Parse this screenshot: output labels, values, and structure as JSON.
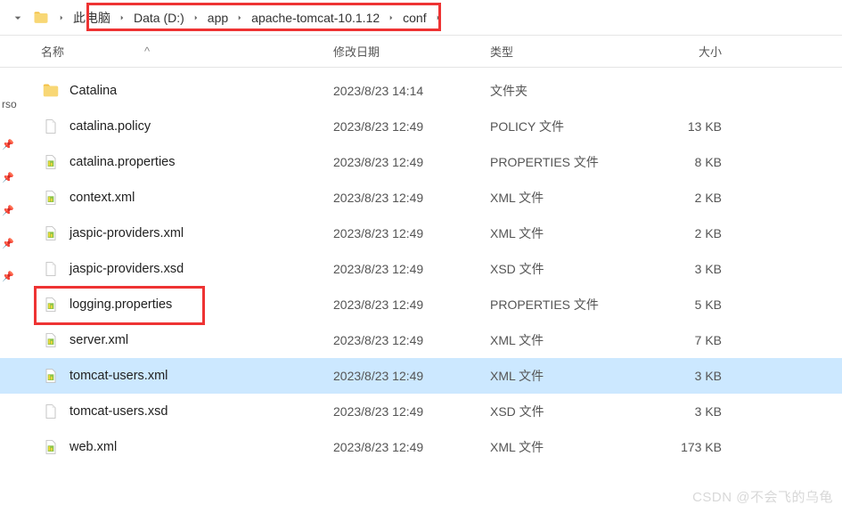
{
  "breadcrumb": {
    "items": [
      {
        "label": "此电脑"
      },
      {
        "label": "Data (D:)"
      },
      {
        "label": "app"
      },
      {
        "label": "apache-tomcat-10.1.12"
      },
      {
        "label": "conf"
      }
    ]
  },
  "headers": {
    "name": "名称",
    "date": "修改日期",
    "type": "类型",
    "size": "大小",
    "sort_indicator": "^"
  },
  "sidebar": {
    "label": "rso"
  },
  "files": [
    {
      "icon": "folder",
      "name": "Catalina",
      "date": "2023/8/23 14:14",
      "type": "文件夹",
      "size": "",
      "selected": false
    },
    {
      "icon": "file",
      "name": "catalina.policy",
      "date": "2023/8/23 12:49",
      "type": "POLICY 文件",
      "size": "13 KB",
      "selected": false
    },
    {
      "icon": "prop",
      "name": "catalina.properties",
      "date": "2023/8/23 12:49",
      "type": "PROPERTIES 文件",
      "size": "8 KB",
      "selected": false
    },
    {
      "icon": "xml",
      "name": "context.xml",
      "date": "2023/8/23 12:49",
      "type": "XML 文件",
      "size": "2 KB",
      "selected": false
    },
    {
      "icon": "xml",
      "name": "jaspic-providers.xml",
      "date": "2023/8/23 12:49",
      "type": "XML 文件",
      "size": "2 KB",
      "selected": false
    },
    {
      "icon": "file",
      "name": "jaspic-providers.xsd",
      "date": "2023/8/23 12:49",
      "type": "XSD 文件",
      "size": "3 KB",
      "selected": false
    },
    {
      "icon": "prop",
      "name": "logging.properties",
      "date": "2023/8/23 12:49",
      "type": "PROPERTIES 文件",
      "size": "5 KB",
      "selected": false
    },
    {
      "icon": "xml",
      "name": "server.xml",
      "date": "2023/8/23 12:49",
      "type": "XML 文件",
      "size": "7 KB",
      "selected": false
    },
    {
      "icon": "xml",
      "name": "tomcat-users.xml",
      "date": "2023/8/23 12:49",
      "type": "XML 文件",
      "size": "3 KB",
      "selected": true
    },
    {
      "icon": "file",
      "name": "tomcat-users.xsd",
      "date": "2023/8/23 12:49",
      "type": "XSD 文件",
      "size": "3 KB",
      "selected": false
    },
    {
      "icon": "xml",
      "name": "web.xml",
      "date": "2023/8/23 12:49",
      "type": "XML 文件",
      "size": "173 KB",
      "selected": false
    }
  ],
  "watermark": "CSDN @不会飞的乌龟"
}
